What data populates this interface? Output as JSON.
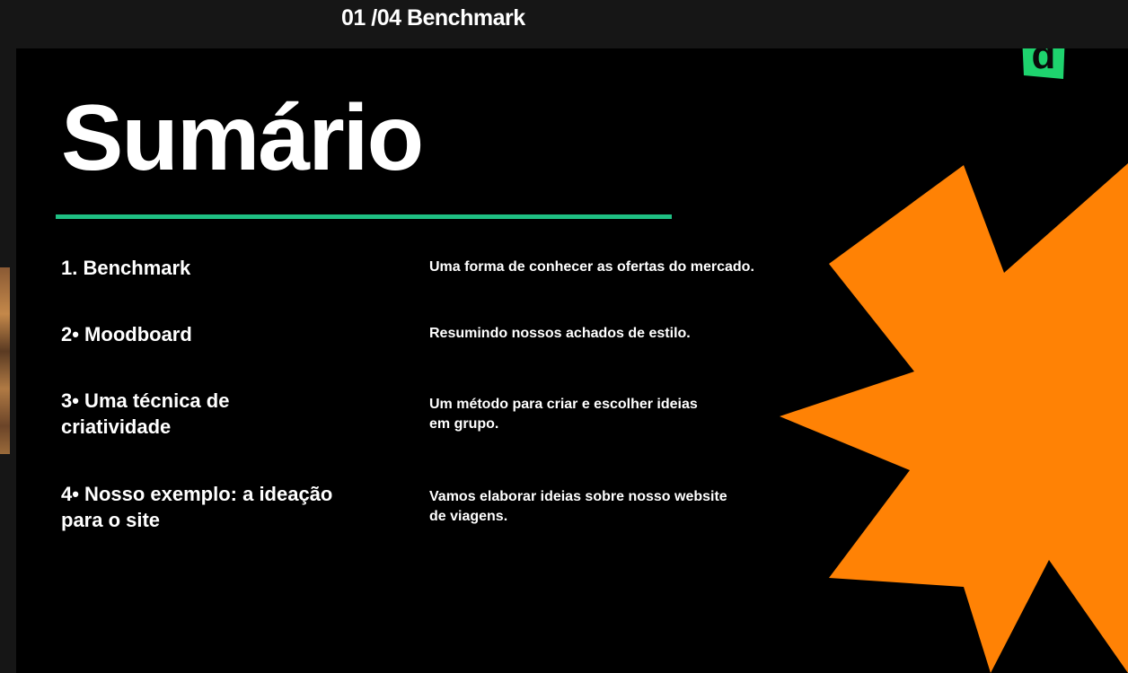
{
  "topbar": {
    "title": "01 /04 Benchmark"
  },
  "slide": {
    "logo": {
      "letter": "d",
      "color": "#1ed36e",
      "icon": "brand-d-logo-icon"
    },
    "heading": "Sumário",
    "accent_color": "#1fbf83",
    "starburst_color": "#ff8205",
    "items": [
      {
        "title": "1. Benchmark",
        "description": "Uma forma de conhecer as ofertas do mercado."
      },
      {
        "title": "2•  Moodboard",
        "description": "Resumindo nossos achados de estilo."
      },
      {
        "title": "3•  Uma técnica de criatividade",
        "description": "Um método para criar e escolher ideias em grupo."
      },
      {
        "title": "4•  Nosso exemplo: a ideação para o site",
        "description": "Vamos  elaborar ideias sobre nosso website de viagens."
      }
    ]
  }
}
